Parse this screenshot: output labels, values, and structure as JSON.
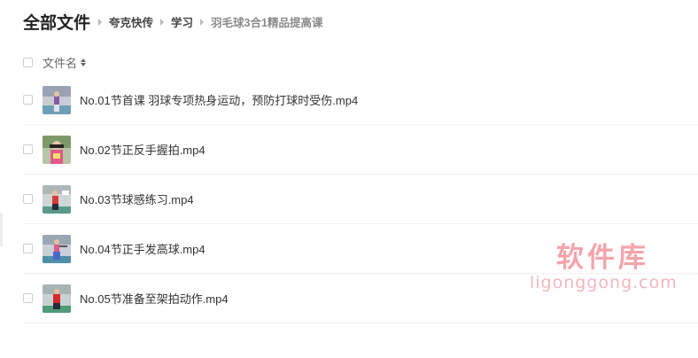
{
  "breadcrumb": {
    "root": "全部文件",
    "items": [
      "夸克快传",
      "学习",
      "羽毛球3合1精品提高课"
    ]
  },
  "list_header": {
    "column_name": "文件名"
  },
  "files": [
    {
      "name": "No.01节首课 羽球专项热身运动，预防打球时受伤.mp4",
      "thumb_color": "#8a5aa8"
    },
    {
      "name": "No.02节正反手握拍.mp4",
      "thumb_color": "#e05a88"
    },
    {
      "name": "No.03节球感练习.mp4",
      "thumb_color": "#d83a3a"
    },
    {
      "name": "No.04节正手发高球.mp4",
      "thumb_color": "#e05a88"
    },
    {
      "name": "No.05节准备至架拍动作.mp4",
      "thumb_color": "#d62a2a"
    }
  ],
  "watermark": {
    "title": "软件库",
    "url": "ligonggong.com"
  }
}
